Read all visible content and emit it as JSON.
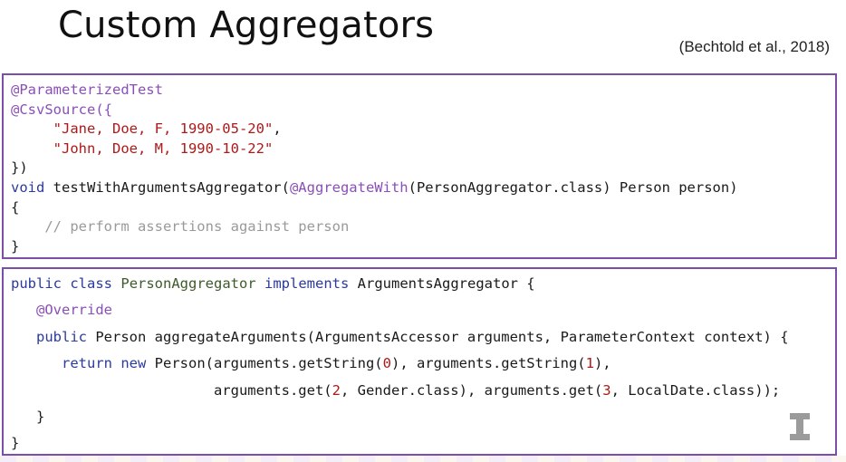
{
  "slide": {
    "title": "Custom Aggregators",
    "citation": "(Bechtold et al., 2018)"
  },
  "code1": {
    "l1": "@ParameterizedTest",
    "l2": "@CsvSource({",
    "l3_indent": "     ",
    "l3_str": "\"Jane, Doe, F, 1990-05-20\"",
    "l3_end": ",",
    "l4_indent": "     ",
    "l4_str": "\"John, Doe, M, 1990-10-22\"",
    "l5": "})",
    "l6_kw": "void",
    "l6_a": " testWithArgumentsAggregator(",
    "l6_ann": "@AggregateWith",
    "l6_b": "(PersonAggregator.class) Person person)",
    "l7": "{",
    "l8_indent": "    ",
    "l8_cmt": "// perform assertions against person",
    "l9": "}"
  },
  "code2": {
    "l1_kw1": "public",
    "l1_sp1": " ",
    "l1_kw2": "class",
    "l1_sp2": " ",
    "l1_cls": "PersonAggregator",
    "l1_sp3": " ",
    "l1_kw3": "implements",
    "l1_rest": " ArgumentsAggregator {",
    "l2_indent": "   ",
    "l2_ann": "@Override",
    "l3_indent": "   ",
    "l3_kw": "public",
    "l3_rest": " Person aggregateArguments(ArgumentsAccessor arguments, ParameterContext context) {",
    "l4_indent": "      ",
    "l4_kw1": "return",
    "l4_sp": " ",
    "l4_kw2": "new",
    "l4_a": " Person(arguments.getString(",
    "l4_n1": "0",
    "l4_b": "), arguments.getString(",
    "l4_n2": "1",
    "l4_c": "),",
    "l5_indent": "                        ",
    "l5_a": "arguments.get(",
    "l5_n1": "2",
    "l5_b": ", Gender.class), arguments.get(",
    "l5_n2": "3",
    "l5_c": ", LocalDate.class));",
    "l6": "   }",
    "l7": "}"
  },
  "logo": {
    "icon": "block-i-logo",
    "color": "#9b9b9b"
  }
}
